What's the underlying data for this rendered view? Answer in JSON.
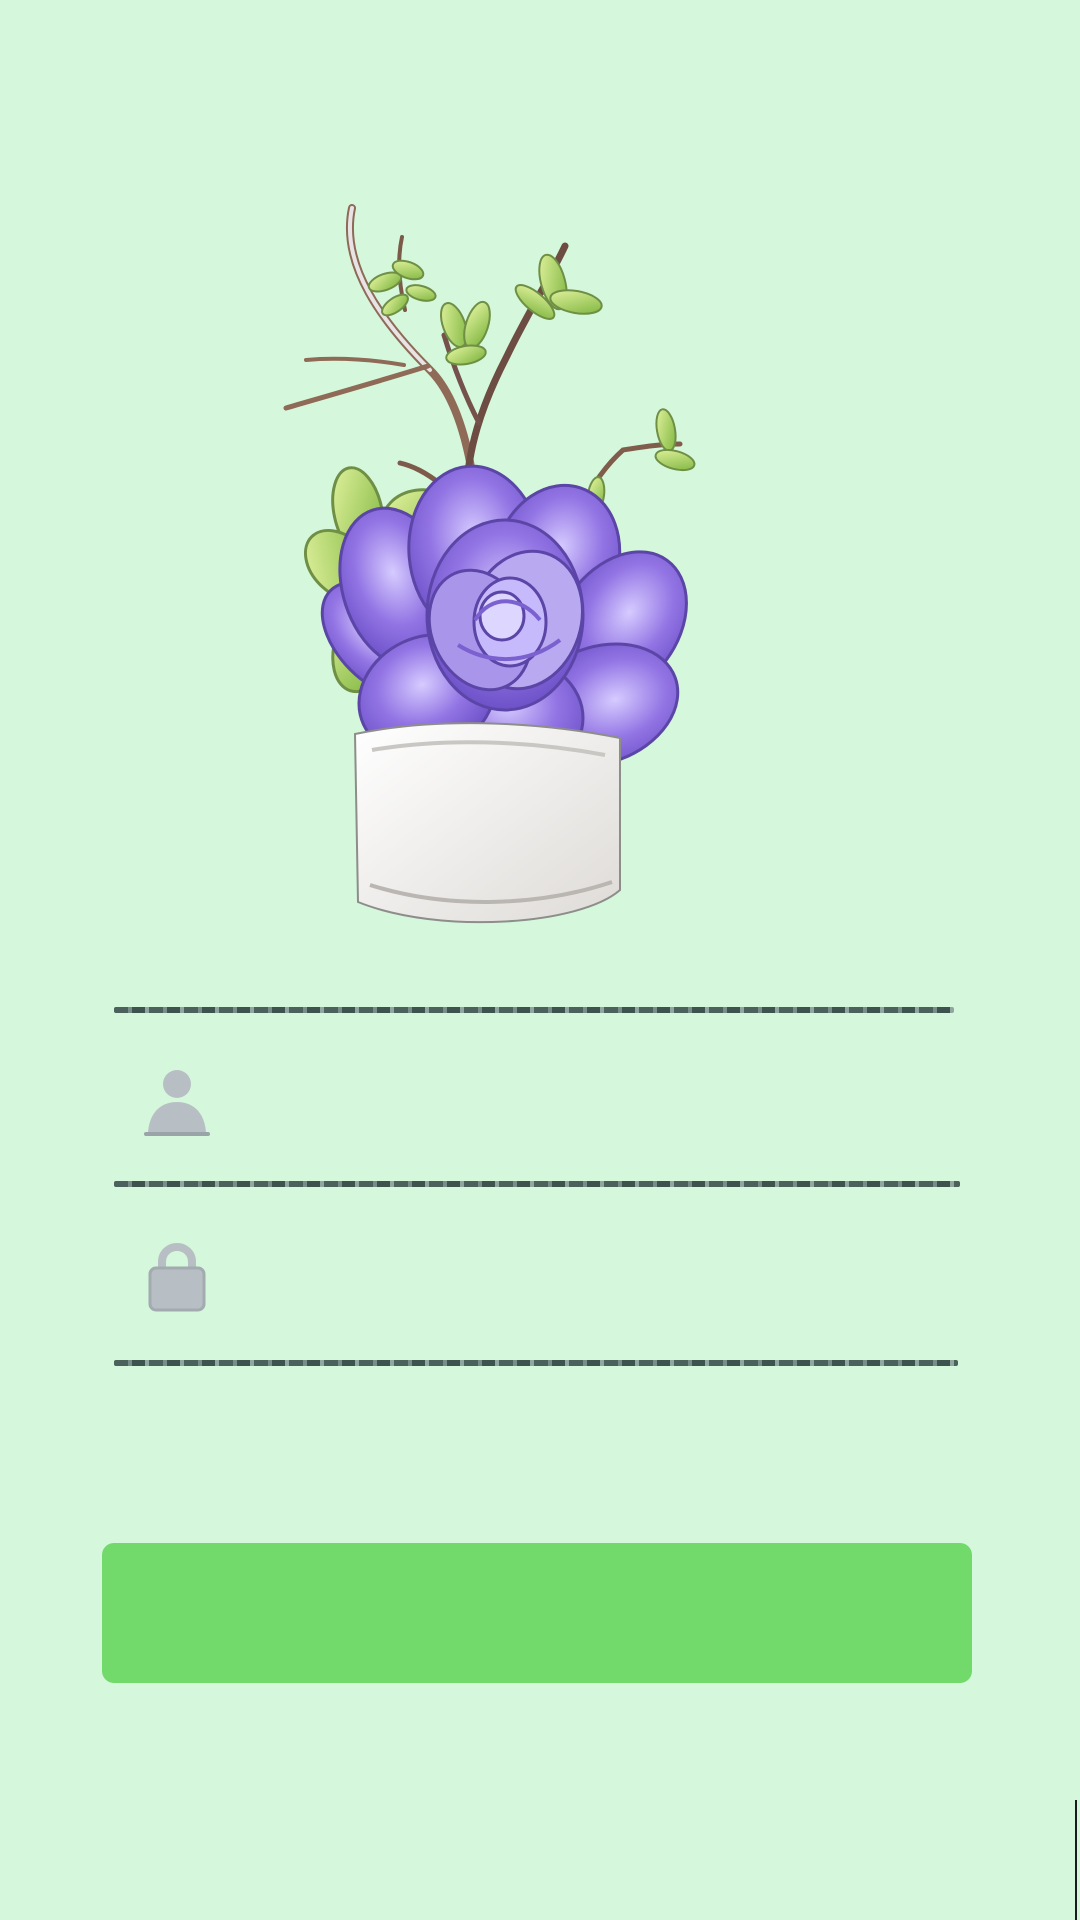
{
  "screen": {
    "background": "#d5f7dc"
  },
  "illustration": {
    "subject": "succulent-pot-illustration"
  },
  "form": {
    "username": {
      "value": "",
      "placeholder": "",
      "icon": "person-icon"
    },
    "password": {
      "value": "",
      "placeholder": "",
      "icon": "lock-icon"
    },
    "submit": {
      "label": "",
      "color": "#72d96b"
    },
    "divider_color": "#3f5450"
  },
  "colors": {
    "accent": "#72d96b",
    "icon": "#b8bfc4",
    "pot": "#f2f0ee",
    "succulent": "#8e72d7",
    "leaf": "#9bc84a"
  }
}
